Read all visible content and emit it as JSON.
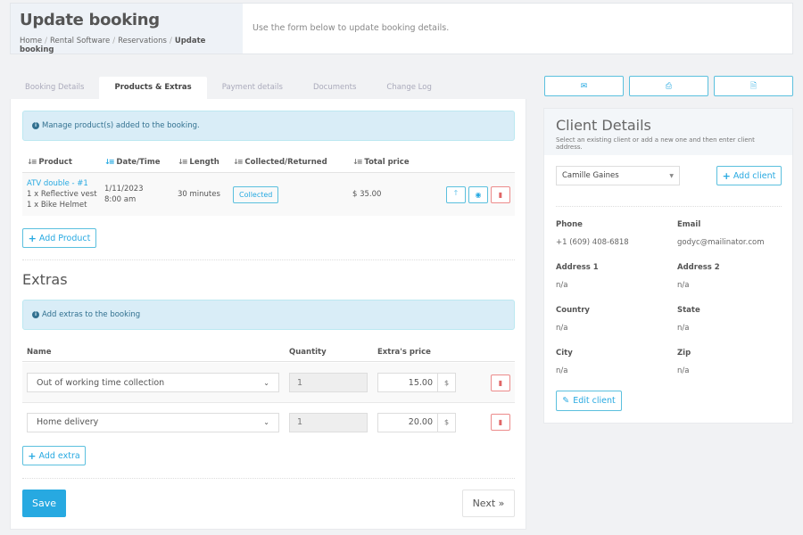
{
  "header": {
    "title": "Update booking",
    "description": "Use the form below to update booking details.",
    "breadcrumb": [
      "Home",
      "Rental Software",
      "Reservations",
      "Update booking"
    ]
  },
  "tabs": [
    {
      "label": "Booking Details",
      "active": false
    },
    {
      "label": "Products & Extras",
      "active": true
    },
    {
      "label": "Payment details",
      "active": false
    },
    {
      "label": "Documents",
      "active": false
    },
    {
      "label": "Change Log",
      "active": false
    }
  ],
  "products": {
    "alert": "Manage product(s) added to the booking.",
    "columns": [
      "Product",
      "Date/Time",
      "Length",
      "Collected/Returned",
      "Total price"
    ],
    "rows": [
      {
        "product": "ATV double - #1",
        "items": [
          "1 x Reflective vest",
          "1 x Bike Helmet"
        ],
        "date": "1/11/2023",
        "time": "8:00 am",
        "length": "30 minutes",
        "status": "Collected",
        "total": "$ 35.00"
      }
    ],
    "add_button": "Add Product"
  },
  "extras": {
    "title": "Extras",
    "alert": "Add extras to the booking",
    "columns": [
      "Name",
      "Quantity",
      "Extra's price"
    ],
    "rows": [
      {
        "name": "Out of working time collection",
        "quantity": "1",
        "price": "15.00",
        "currency": "$"
      },
      {
        "name": "Home delivery",
        "quantity": "1",
        "price": "20.00",
        "currency": "$"
      }
    ],
    "add_button": "Add extra"
  },
  "footer": {
    "save": "Save",
    "next": "Next »"
  },
  "client": {
    "title": "Client Details",
    "subtitle": "Select an existing client or add a new one and then enter client address.",
    "selected": "Camille Gaines",
    "add_button": "Add client",
    "edit_button": "Edit client",
    "fields": {
      "phone_label": "Phone",
      "phone": "+1 (609) 408-6818",
      "email_label": "Email",
      "email": "godyc@mailinator.com",
      "address1_label": "Address 1",
      "address1": "n/a",
      "address2_label": "Address 2",
      "address2": "n/a",
      "country_label": "Country",
      "country": "n/a",
      "state_label": "State",
      "state": "n/a",
      "city_label": "City",
      "city": "n/a",
      "zip_label": "Zip",
      "zip": "n/a"
    }
  },
  "colors": {
    "accent": "#27a9e1",
    "danger": "#e06666",
    "info_bg": "#d9edf7"
  }
}
